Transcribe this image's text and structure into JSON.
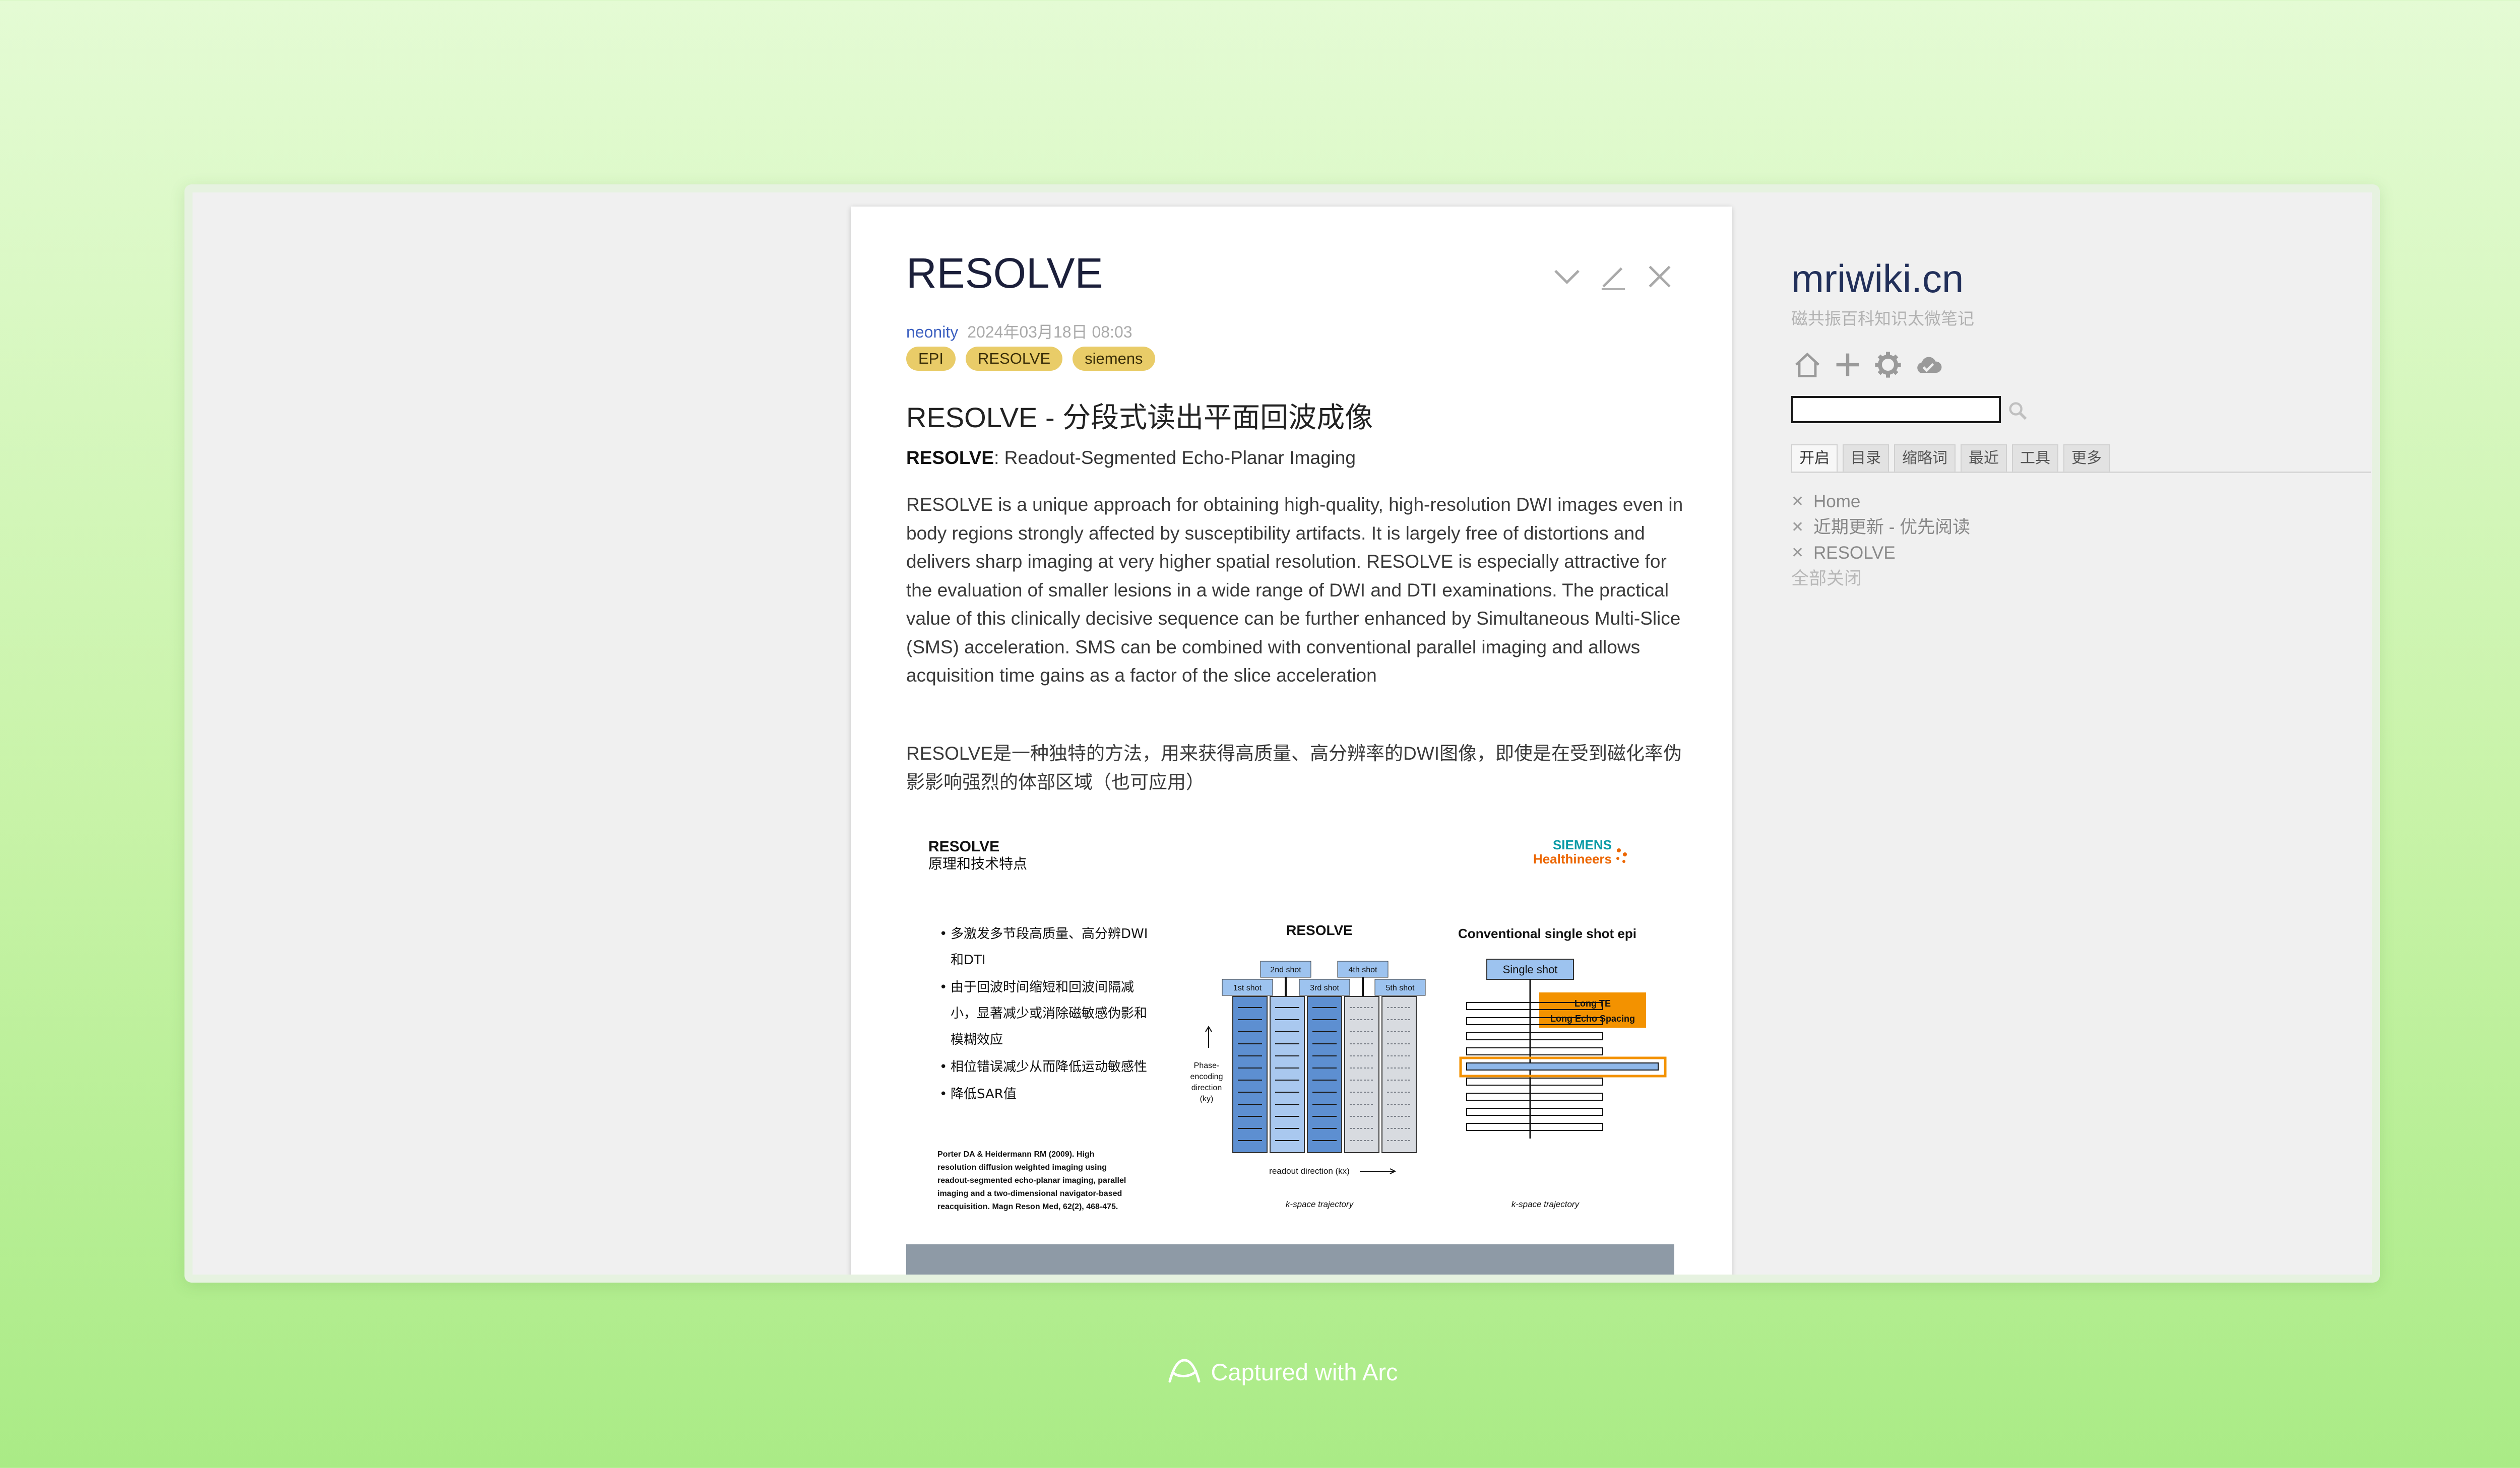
{
  "tiddler": {
    "title": "RESOLVE",
    "author": "neonity",
    "date": "2024年03月18日 08:03",
    "tags": [
      "EPI",
      "RESOLVE",
      "siemens"
    ],
    "heading": "RESOLVE - 分段式读出平面回波成像",
    "subtitle_bold": "RESOLVE",
    "subtitle_rest": ": Readout-Segmented Echo-Planar Imaging",
    "paragraph_en": "RESOLVE is a unique approach for obtaining high-quality, high-resolution DWI images even in body regions strongly affected by susceptibility artifacts. It is largely free of distortions and delivers sharp imaging at very higher spatial resolution. RESOLVE is especially attractive for the evaluation of smaller lesions in a wide range of DWI and DTI examinations. The practical value of this clinically decisive sequence can be further enhanced by Simultaneous Multi-Slice (SMS) acceleration. SMS can be combined with conventional parallel imaging and allows acquisition time gains as a factor of the slice acceleration",
    "paragraph_cn": "RESOLVE是一种独特的方法，用来获得高质量、高分辨率的DWI图像，即使是在受到磁化率伪影影响强烈的体部区域（也可应用）",
    "slide": {
      "title": "RESOLVE",
      "subtitle": "原理和技术特点",
      "brand_line1": "SIEMENS",
      "brand_line2": "Healthineers",
      "bullets": [
        "多激发多节段高质量、高分辨DWI",
        "和DTI",
        "由于回波时间缩短和回波间隔减",
        "小，显著减少或消除磁敏感伪影和",
        "模糊效应",
        "相位错误减少从而降低运动敏感性",
        "降低SAR值"
      ],
      "reference": [
        "Porter DA & Heidermann RM (2009). High",
        "resolution diffusion weighted imaging using",
        "readout-segmented echo-planar imaging, parallel",
        "imaging and a two-dimensional navigator-based",
        "reacquisition. Magn Reson Med, 62(2), 468-475."
      ],
      "diagram_title_left": "RESOLVE",
      "diagram_title_right": "Conventional single shot epi",
      "shots": [
        "1st shot",
        "2nd shot",
        "3rd shot",
        "4th shot",
        "5th shot"
      ],
      "single_shot": "Single shot",
      "long_te": "Long TE",
      "long_echo": "Long Echo Spacing",
      "phase_label": [
        "Phase-",
        "encoding",
        "direction",
        "(ky)"
      ],
      "readout_label": "readout direction (kx)",
      "kspace_left": "k-space trajectory",
      "kspace_right": "k-space trajectory"
    }
  },
  "sidebar": {
    "site_title": "mriwiki.cn",
    "site_subtitle": "磁共振百科知识太微笔记",
    "search_value": "",
    "tabs": [
      "开启",
      "目录",
      "缩略词",
      "最近",
      "工具",
      "更多"
    ],
    "open_items": [
      "Home",
      "近期更新 - 优先阅读",
      "RESOLVE"
    ],
    "close_all": "全部关闭"
  },
  "footer": {
    "captured": "Captured with Arc"
  },
  "colors": {
    "accent_tag": "#e9cc68",
    "author_link": "#3b5fc0",
    "siemens_teal": "#0a9aa6",
    "healthineers_orange": "#ec6602"
  }
}
